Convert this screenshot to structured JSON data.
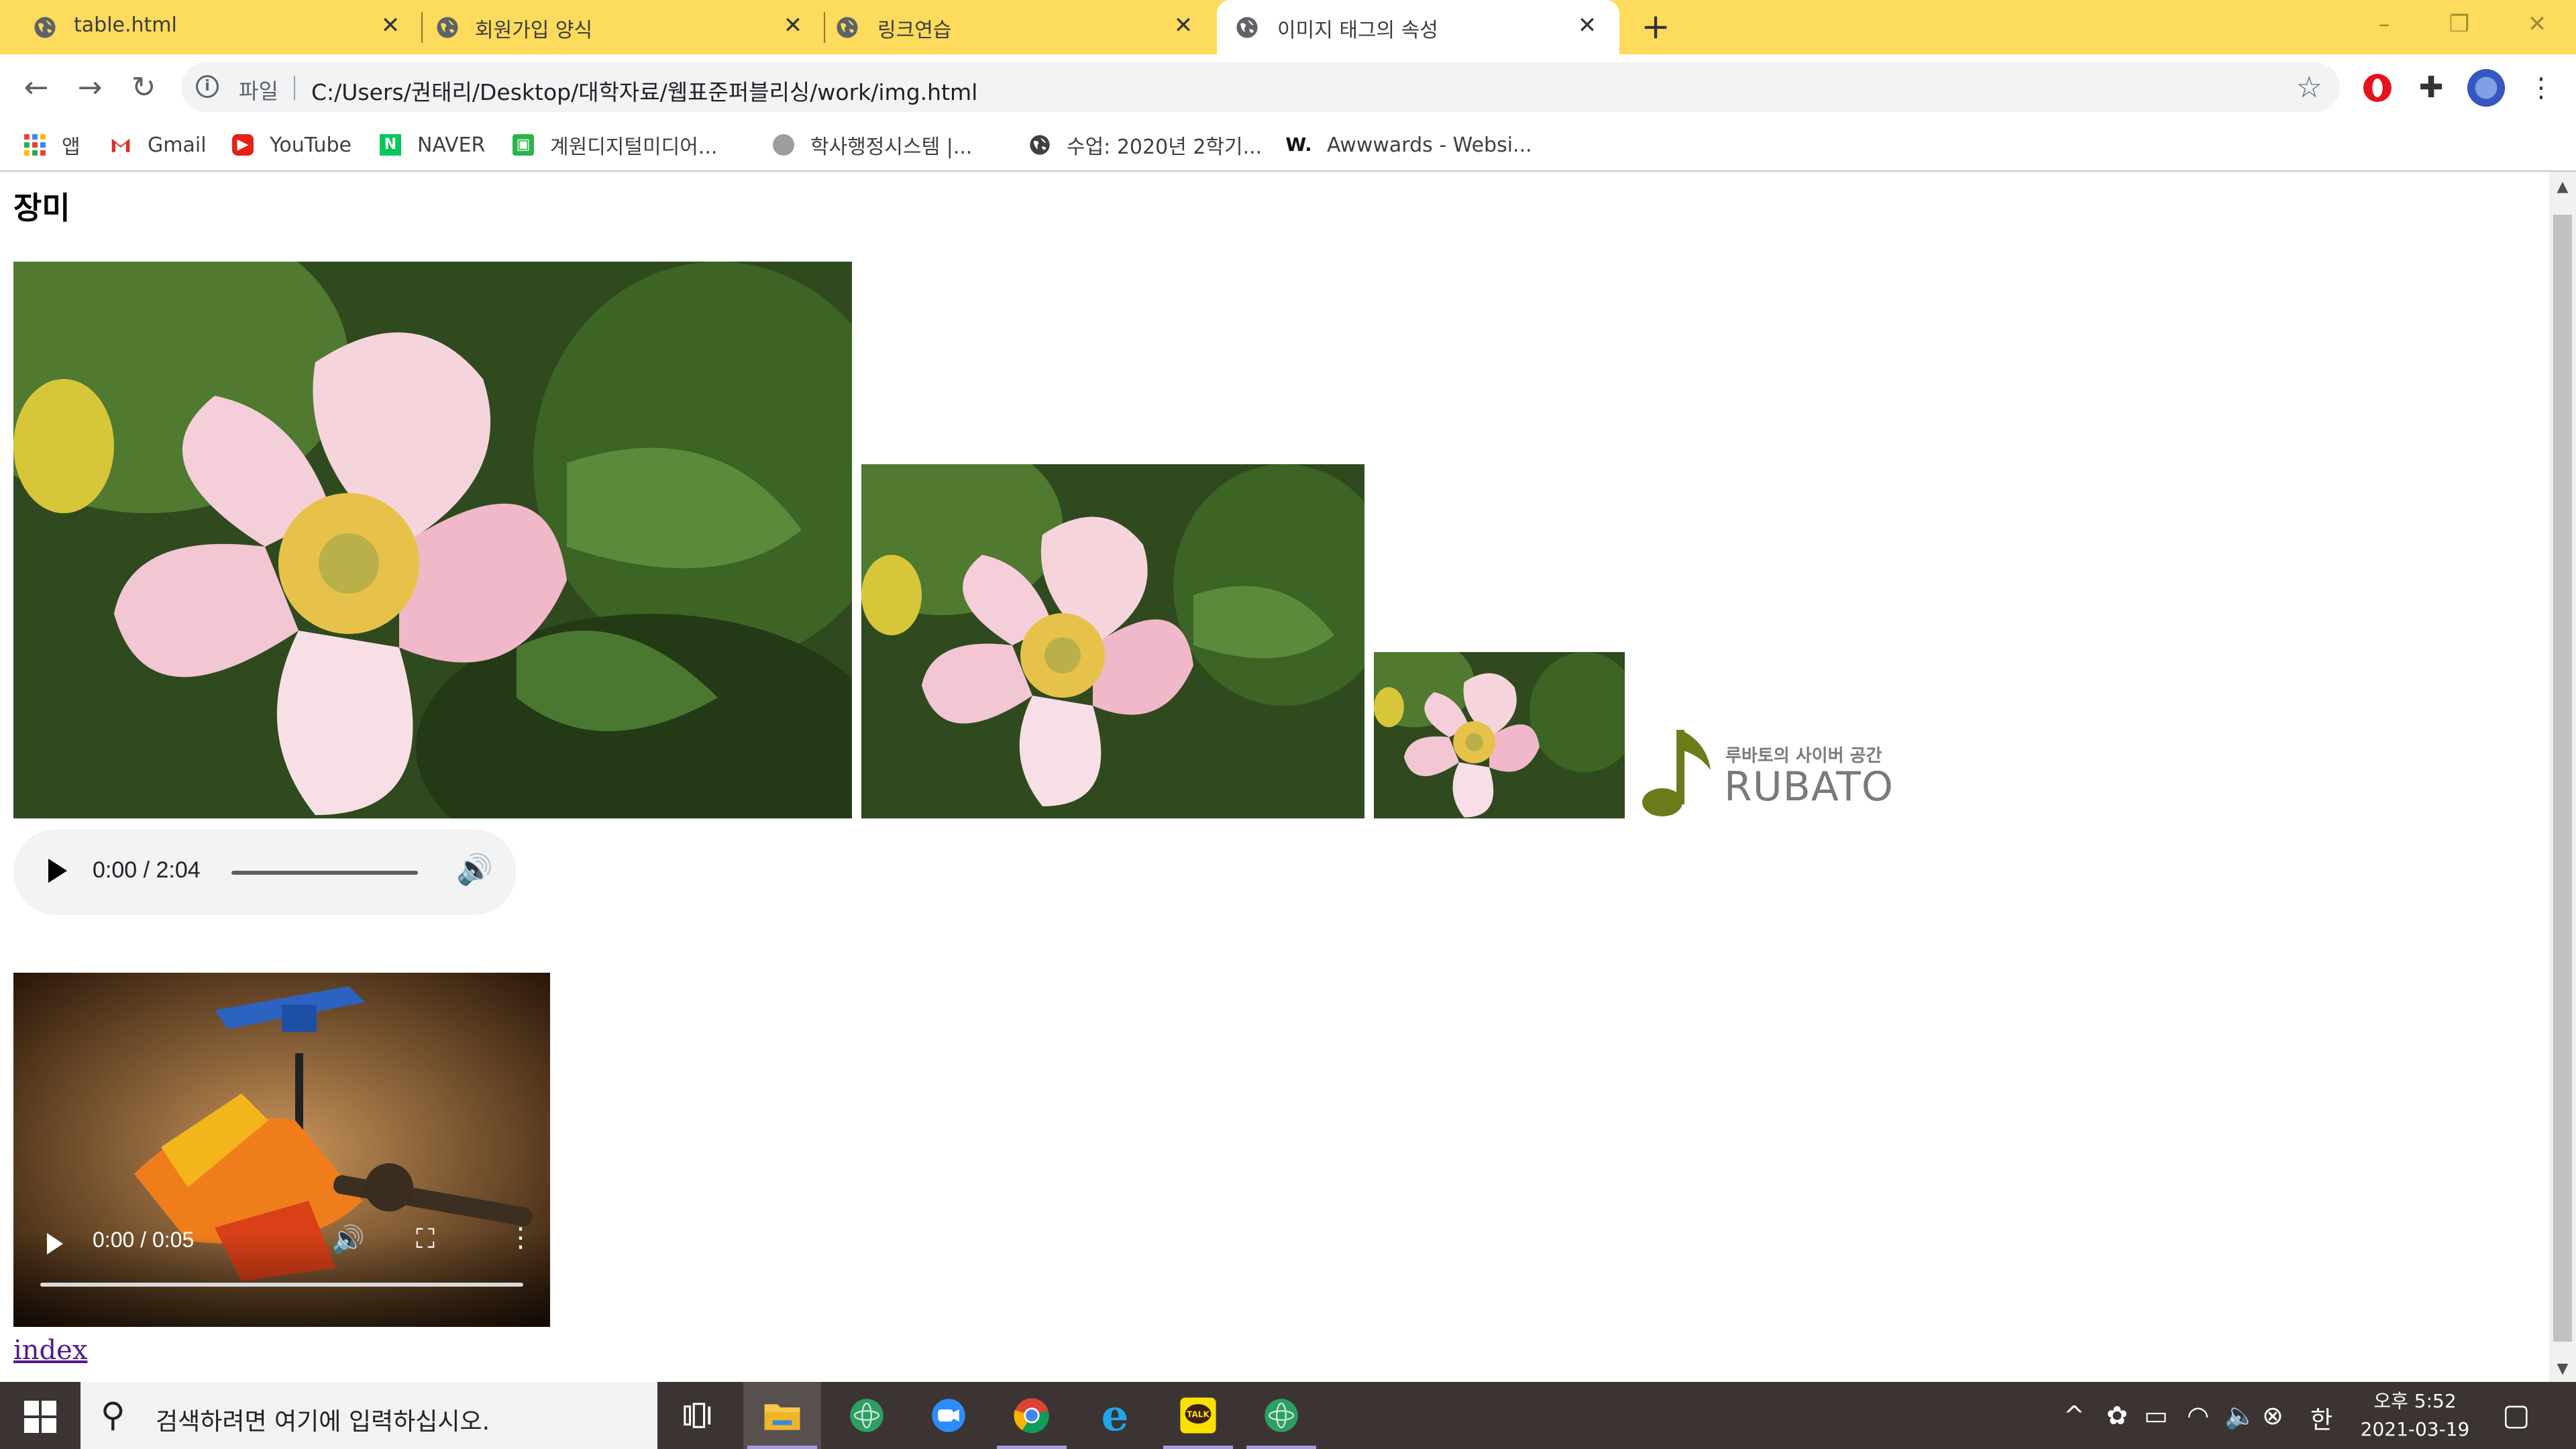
{
  "browser": {
    "tabs": [
      {
        "label": "table.html",
        "active": false
      },
      {
        "label": "회원가입 양식",
        "active": false
      },
      {
        "label": "링크연습",
        "active": false
      },
      {
        "label": "이미지 태그의 속성",
        "active": true
      }
    ],
    "address": {
      "scheme_label": "파일",
      "url": "C:/Users/권태리/Desktop/대학자료/웹표준퍼블리싱/work/img.html"
    },
    "bookmarks": [
      {
        "label": "앱",
        "icon": "apps-grid-icon"
      },
      {
        "label": "Gmail",
        "icon": "gmail-icon"
      },
      {
        "label": "YouTube",
        "icon": "youtube-icon"
      },
      {
        "label": "NAVER",
        "icon": "naver-icon"
      },
      {
        "label": "계원디지털미디어...",
        "icon": "kaywon-icon"
      },
      {
        "label": "학사행정시스템 |...",
        "icon": "system-icon"
      },
      {
        "label": "수업: 2020년 2학기...",
        "icon": "globe-icon"
      },
      {
        "label": "Awwwards - Websi...",
        "icon": "awwwards-icon"
      }
    ]
  },
  "page": {
    "heading": "장미",
    "logo": {
      "tagline": "루바토의 사이버 공간",
      "wordmark": "RUBATO",
      "color": "#6b7d1a"
    },
    "audio": {
      "time": "0:00 / 2:04"
    },
    "video": {
      "time": "0:00 / 0:05"
    },
    "link": "index"
  },
  "taskbar": {
    "search_placeholder": "검색하려면 여기에 입력하십시오.",
    "ime": "한",
    "clock": {
      "time": "오후 5:52",
      "date": "2021-03-19"
    }
  },
  "colors": {
    "tabstrip": "#fddb5c",
    "taskbar": "#3b3433",
    "link": "#551a8b"
  }
}
